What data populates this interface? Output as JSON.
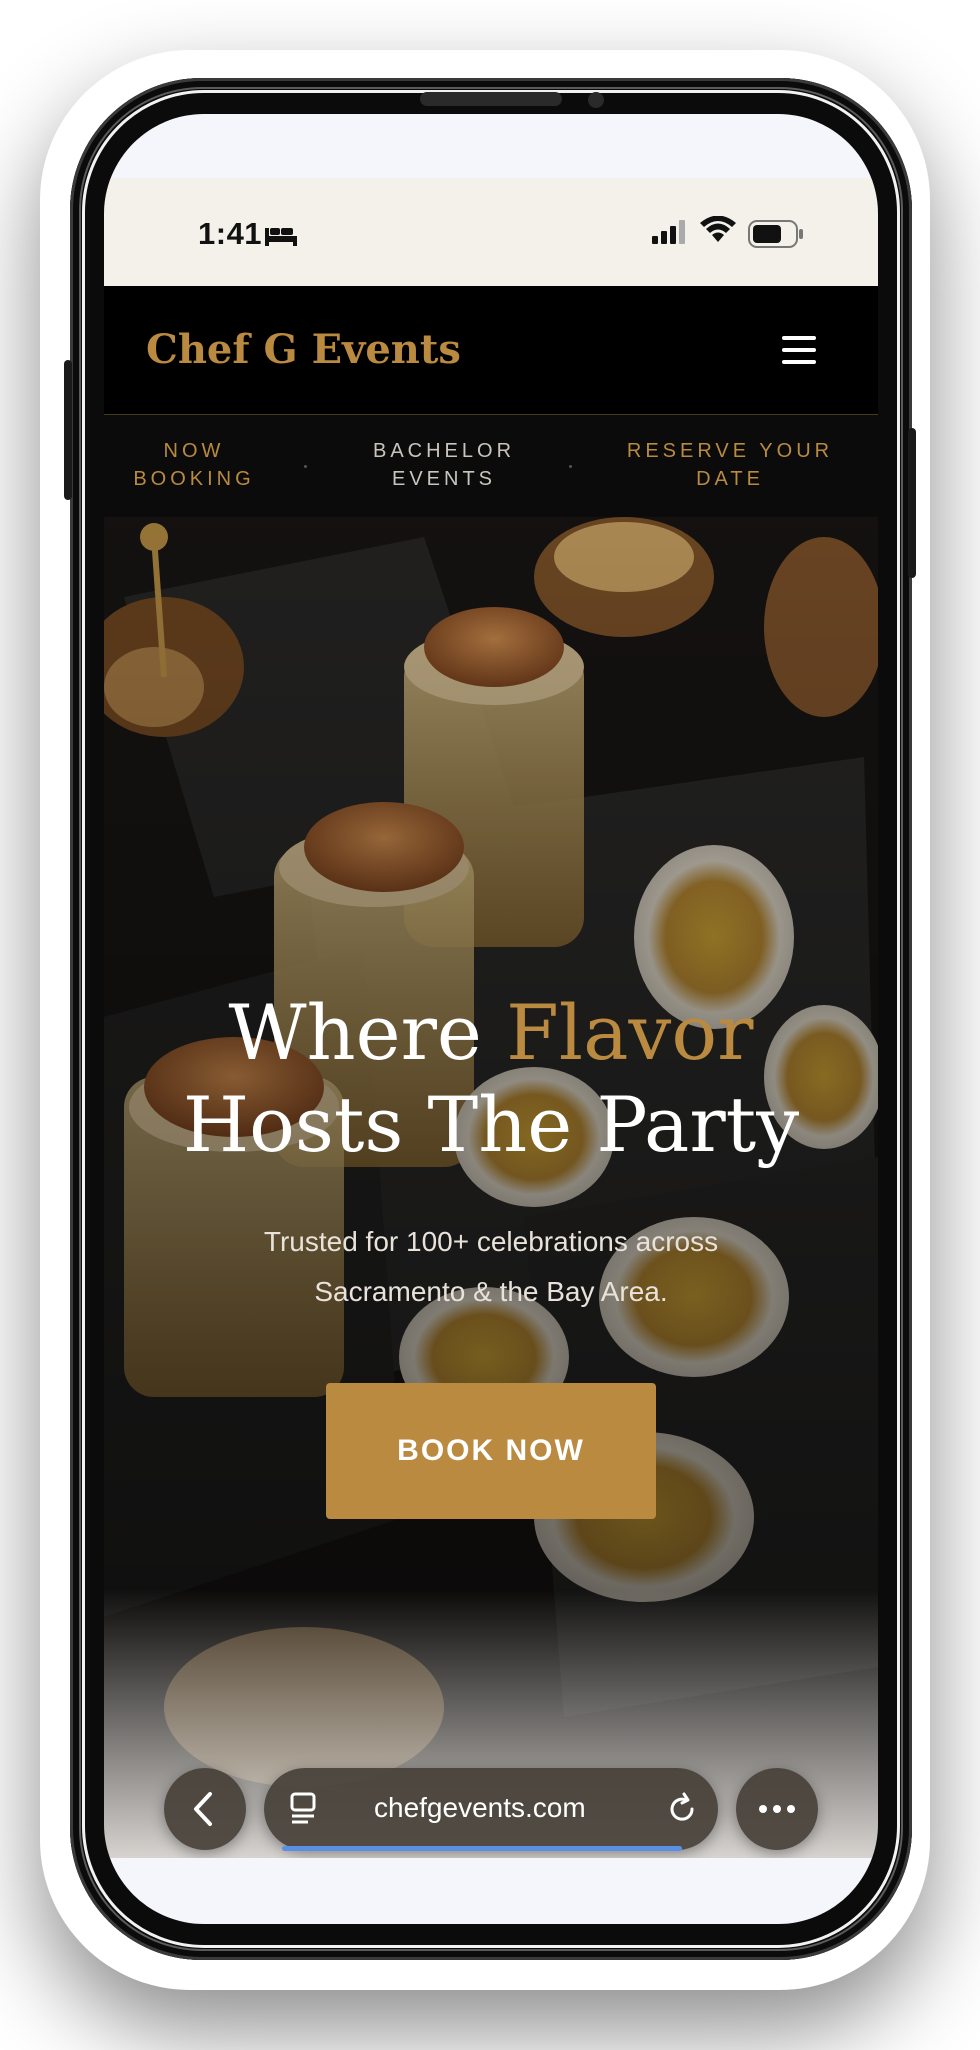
{
  "status_bar": {
    "time": "1:41"
  },
  "site": {
    "logo": "Chef G Events",
    "subnav": [
      "NOW BOOKING",
      "BACHELOR EVENTS",
      "RESERVE YOUR DATE"
    ]
  },
  "hero": {
    "title_line1_a": "Where ",
    "title_line1_b": "Flavor",
    "title_line2": "Hosts The Party",
    "subtitle": "Trusted for 100+ celebrations across Sacramento & the Bay Area.",
    "cta": "BOOK NOW"
  },
  "browser": {
    "url": "chefgevents.com"
  },
  "colors": {
    "accent": "#b98a3f",
    "background": "#000000",
    "progress": "#5b8fe6"
  },
  "icons": [
    "sleep-icon",
    "signal-icon",
    "wifi-icon",
    "battery-icon",
    "menu-icon",
    "back-icon",
    "tabs-icon",
    "reload-icon",
    "more-icon"
  ]
}
